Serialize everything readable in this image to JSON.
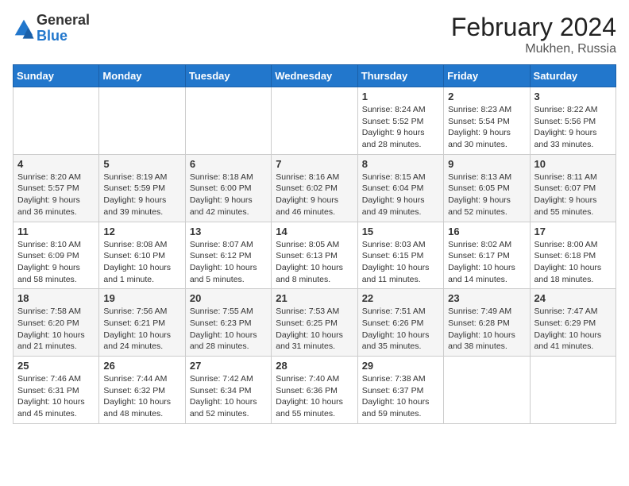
{
  "header": {
    "logo_general": "General",
    "logo_blue": "Blue",
    "month_year": "February 2024",
    "location": "Mukhen, Russia"
  },
  "weekdays": [
    "Sunday",
    "Monday",
    "Tuesday",
    "Wednesday",
    "Thursday",
    "Friday",
    "Saturday"
  ],
  "weeks": [
    [
      {
        "day": "",
        "info": ""
      },
      {
        "day": "",
        "info": ""
      },
      {
        "day": "",
        "info": ""
      },
      {
        "day": "",
        "info": ""
      },
      {
        "day": "1",
        "info": "Sunrise: 8:24 AM\nSunset: 5:52 PM\nDaylight: 9 hours and 28 minutes."
      },
      {
        "day": "2",
        "info": "Sunrise: 8:23 AM\nSunset: 5:54 PM\nDaylight: 9 hours and 30 minutes."
      },
      {
        "day": "3",
        "info": "Sunrise: 8:22 AM\nSunset: 5:56 PM\nDaylight: 9 hours and 33 minutes."
      }
    ],
    [
      {
        "day": "4",
        "info": "Sunrise: 8:20 AM\nSunset: 5:57 PM\nDaylight: 9 hours and 36 minutes."
      },
      {
        "day": "5",
        "info": "Sunrise: 8:19 AM\nSunset: 5:59 PM\nDaylight: 9 hours and 39 minutes."
      },
      {
        "day": "6",
        "info": "Sunrise: 8:18 AM\nSunset: 6:00 PM\nDaylight: 9 hours and 42 minutes."
      },
      {
        "day": "7",
        "info": "Sunrise: 8:16 AM\nSunset: 6:02 PM\nDaylight: 9 hours and 46 minutes."
      },
      {
        "day": "8",
        "info": "Sunrise: 8:15 AM\nSunset: 6:04 PM\nDaylight: 9 hours and 49 minutes."
      },
      {
        "day": "9",
        "info": "Sunrise: 8:13 AM\nSunset: 6:05 PM\nDaylight: 9 hours and 52 minutes."
      },
      {
        "day": "10",
        "info": "Sunrise: 8:11 AM\nSunset: 6:07 PM\nDaylight: 9 hours and 55 minutes."
      }
    ],
    [
      {
        "day": "11",
        "info": "Sunrise: 8:10 AM\nSunset: 6:09 PM\nDaylight: 9 hours and 58 minutes."
      },
      {
        "day": "12",
        "info": "Sunrise: 8:08 AM\nSunset: 6:10 PM\nDaylight: 10 hours and 1 minute."
      },
      {
        "day": "13",
        "info": "Sunrise: 8:07 AM\nSunset: 6:12 PM\nDaylight: 10 hours and 5 minutes."
      },
      {
        "day": "14",
        "info": "Sunrise: 8:05 AM\nSunset: 6:13 PM\nDaylight: 10 hours and 8 minutes."
      },
      {
        "day": "15",
        "info": "Sunrise: 8:03 AM\nSunset: 6:15 PM\nDaylight: 10 hours and 11 minutes."
      },
      {
        "day": "16",
        "info": "Sunrise: 8:02 AM\nSunset: 6:17 PM\nDaylight: 10 hours and 14 minutes."
      },
      {
        "day": "17",
        "info": "Sunrise: 8:00 AM\nSunset: 6:18 PM\nDaylight: 10 hours and 18 minutes."
      }
    ],
    [
      {
        "day": "18",
        "info": "Sunrise: 7:58 AM\nSunset: 6:20 PM\nDaylight: 10 hours and 21 minutes."
      },
      {
        "day": "19",
        "info": "Sunrise: 7:56 AM\nSunset: 6:21 PM\nDaylight: 10 hours and 24 minutes."
      },
      {
        "day": "20",
        "info": "Sunrise: 7:55 AM\nSunset: 6:23 PM\nDaylight: 10 hours and 28 minutes."
      },
      {
        "day": "21",
        "info": "Sunrise: 7:53 AM\nSunset: 6:25 PM\nDaylight: 10 hours and 31 minutes."
      },
      {
        "day": "22",
        "info": "Sunrise: 7:51 AM\nSunset: 6:26 PM\nDaylight: 10 hours and 35 minutes."
      },
      {
        "day": "23",
        "info": "Sunrise: 7:49 AM\nSunset: 6:28 PM\nDaylight: 10 hours and 38 minutes."
      },
      {
        "day": "24",
        "info": "Sunrise: 7:47 AM\nSunset: 6:29 PM\nDaylight: 10 hours and 41 minutes."
      }
    ],
    [
      {
        "day": "25",
        "info": "Sunrise: 7:46 AM\nSunset: 6:31 PM\nDaylight: 10 hours and 45 minutes."
      },
      {
        "day": "26",
        "info": "Sunrise: 7:44 AM\nSunset: 6:32 PM\nDaylight: 10 hours and 48 minutes."
      },
      {
        "day": "27",
        "info": "Sunrise: 7:42 AM\nSunset: 6:34 PM\nDaylight: 10 hours and 52 minutes."
      },
      {
        "day": "28",
        "info": "Sunrise: 7:40 AM\nSunset: 6:36 PM\nDaylight: 10 hours and 55 minutes."
      },
      {
        "day": "29",
        "info": "Sunrise: 7:38 AM\nSunset: 6:37 PM\nDaylight: 10 hours and 59 minutes."
      },
      {
        "day": "",
        "info": ""
      },
      {
        "day": "",
        "info": ""
      }
    ]
  ]
}
